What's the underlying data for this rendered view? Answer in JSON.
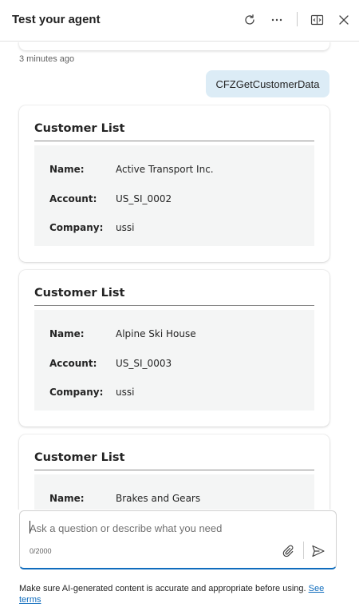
{
  "header": {
    "title": "Test your agent"
  },
  "chat": {
    "timestamp": "3 minutes ago",
    "user_message": "CFZGetCustomerData",
    "cards": [
      {
        "title": "Customer List",
        "facts": [
          {
            "label": "Name:",
            "value": "Active Transport Inc."
          },
          {
            "label": "Account:",
            "value": "US_SI_0002"
          },
          {
            "label": "Company:",
            "value": "ussi"
          }
        ]
      },
      {
        "title": "Customer List",
        "facts": [
          {
            "label": "Name:",
            "value": "Alpine Ski House"
          },
          {
            "label": "Account:",
            "value": "US_SI_0003"
          },
          {
            "label": "Company:",
            "value": "ussi"
          }
        ]
      },
      {
        "title": "Customer List",
        "facts": [
          {
            "label": "Name:",
            "value": "Brakes and Gears"
          }
        ]
      }
    ]
  },
  "composer": {
    "placeholder": "Ask a question or describe what you need",
    "char_count": "0/2000"
  },
  "footer": {
    "disclaimer": "Make sure AI-generated content is accurate and appropriate before using.",
    "link_text_1": "See",
    "link_text_2": "terms"
  },
  "colors": {
    "accent": "#0f6cbd",
    "user_bubble": "#dcecf6",
    "factset_bg": "#f4f5f5"
  },
  "icons": [
    "refresh-icon",
    "more-icon",
    "panel-icon",
    "close-icon",
    "attach-icon",
    "send-icon"
  ]
}
